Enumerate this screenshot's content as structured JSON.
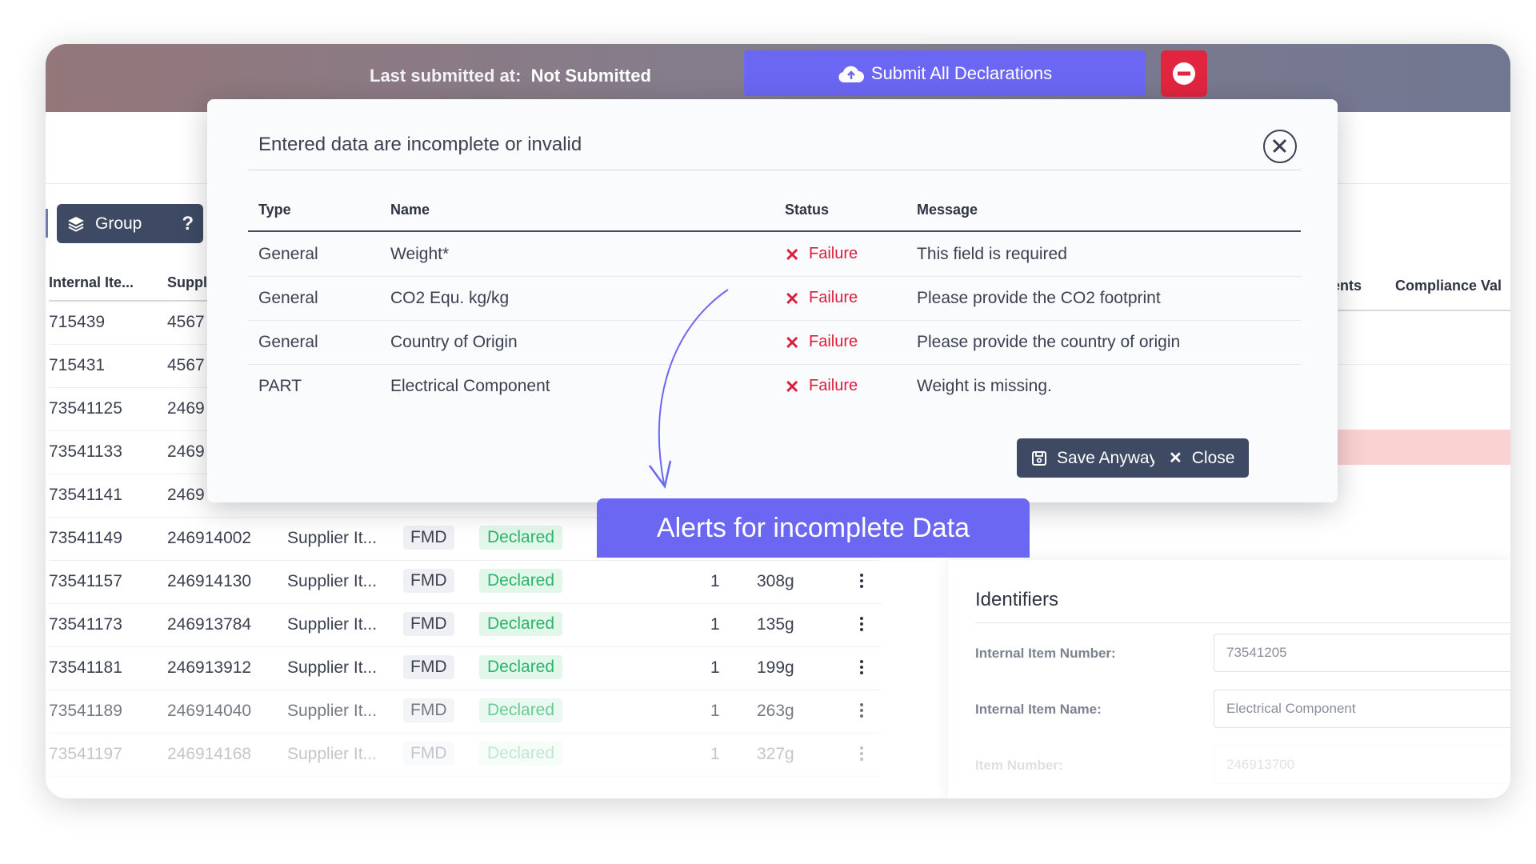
{
  "topbar": {
    "last_submitted_label": "Last submitted at:",
    "last_submitted_value": "Not Submitted",
    "submit_label": "Submit All Declarations"
  },
  "toolbar": {
    "group_label": "Group",
    "help_label": "?"
  },
  "table": {
    "headers": [
      "Internal Ite...",
      "Suppl"
    ],
    "rows": [
      {
        "internal": "715439",
        "supplier": "4567"
      },
      {
        "internal": "715431",
        "supplier": "4567"
      },
      {
        "internal": "73541125",
        "supplier": "2469"
      },
      {
        "internal": "73541133",
        "supplier": "2469"
      },
      {
        "internal": "73541141",
        "supplier": "2469"
      },
      {
        "internal": "73541149",
        "supplier": "246914002",
        "name": "Supplier It...",
        "type": "FMD",
        "status": "Declared",
        "qty": "1",
        "weight": ""
      },
      {
        "internal": "73541157",
        "supplier": "246914130",
        "name": "Supplier It...",
        "type": "FMD",
        "status": "Declared",
        "qty": "1",
        "weight": "308g"
      },
      {
        "internal": "73541173",
        "supplier": "246913784",
        "name": "Supplier It...",
        "type": "FMD",
        "status": "Declared",
        "qty": "1",
        "weight": "135g"
      },
      {
        "internal": "73541181",
        "supplier": "246913912",
        "name": "Supplier It...",
        "type": "FMD",
        "status": "Declared",
        "qty": "1",
        "weight": "199g"
      },
      {
        "internal": "73541189",
        "supplier": "246914040",
        "name": "Supplier It...",
        "type": "FMD",
        "status": "Declared",
        "qty": "1",
        "weight": "263g"
      },
      {
        "internal": "73541197",
        "supplier": "246914168",
        "name": "Supplier It...",
        "type": "FMD",
        "status": "Declared",
        "qty": "1",
        "weight": "327g"
      }
    ]
  },
  "right_panel": {
    "col_partial": "ents",
    "col_compliance": "Compliance Val",
    "identifiers": {
      "title": "Identifiers",
      "fields": [
        {
          "label": "Internal Item Number:",
          "value": "73541205"
        },
        {
          "label": "Internal Item Name:",
          "value": "Electrical Component"
        },
        {
          "label": "Item Number:",
          "value": "246913700"
        }
      ]
    }
  },
  "modal": {
    "title": "Entered data are incomplete or invalid",
    "headers": {
      "type": "Type",
      "name": "Name",
      "status": "Status",
      "message": "Message"
    },
    "rows": [
      {
        "type": "General",
        "name": "Weight*",
        "status": "Failure",
        "message": "This field is required"
      },
      {
        "type": "General",
        "name": "CO2 Equ. kg/kg",
        "status": "Failure",
        "message": "Please provide the CO2 footprint"
      },
      {
        "type": "General",
        "name": "Country of Origin",
        "status": "Failure",
        "message": "Please provide the country of origin"
      },
      {
        "type": "PART",
        "name": "Electrical Component",
        "status": "Failure",
        "message": "Weight is missing."
      }
    ],
    "save_label": "Save Anyway",
    "close_label": "Close"
  },
  "callout": "Alerts for incomplete Data",
  "colors": {
    "accent": "#6c67f3",
    "danger": "#dc1d3f",
    "dark": "#3e4a64",
    "success": "#2ab56a"
  }
}
